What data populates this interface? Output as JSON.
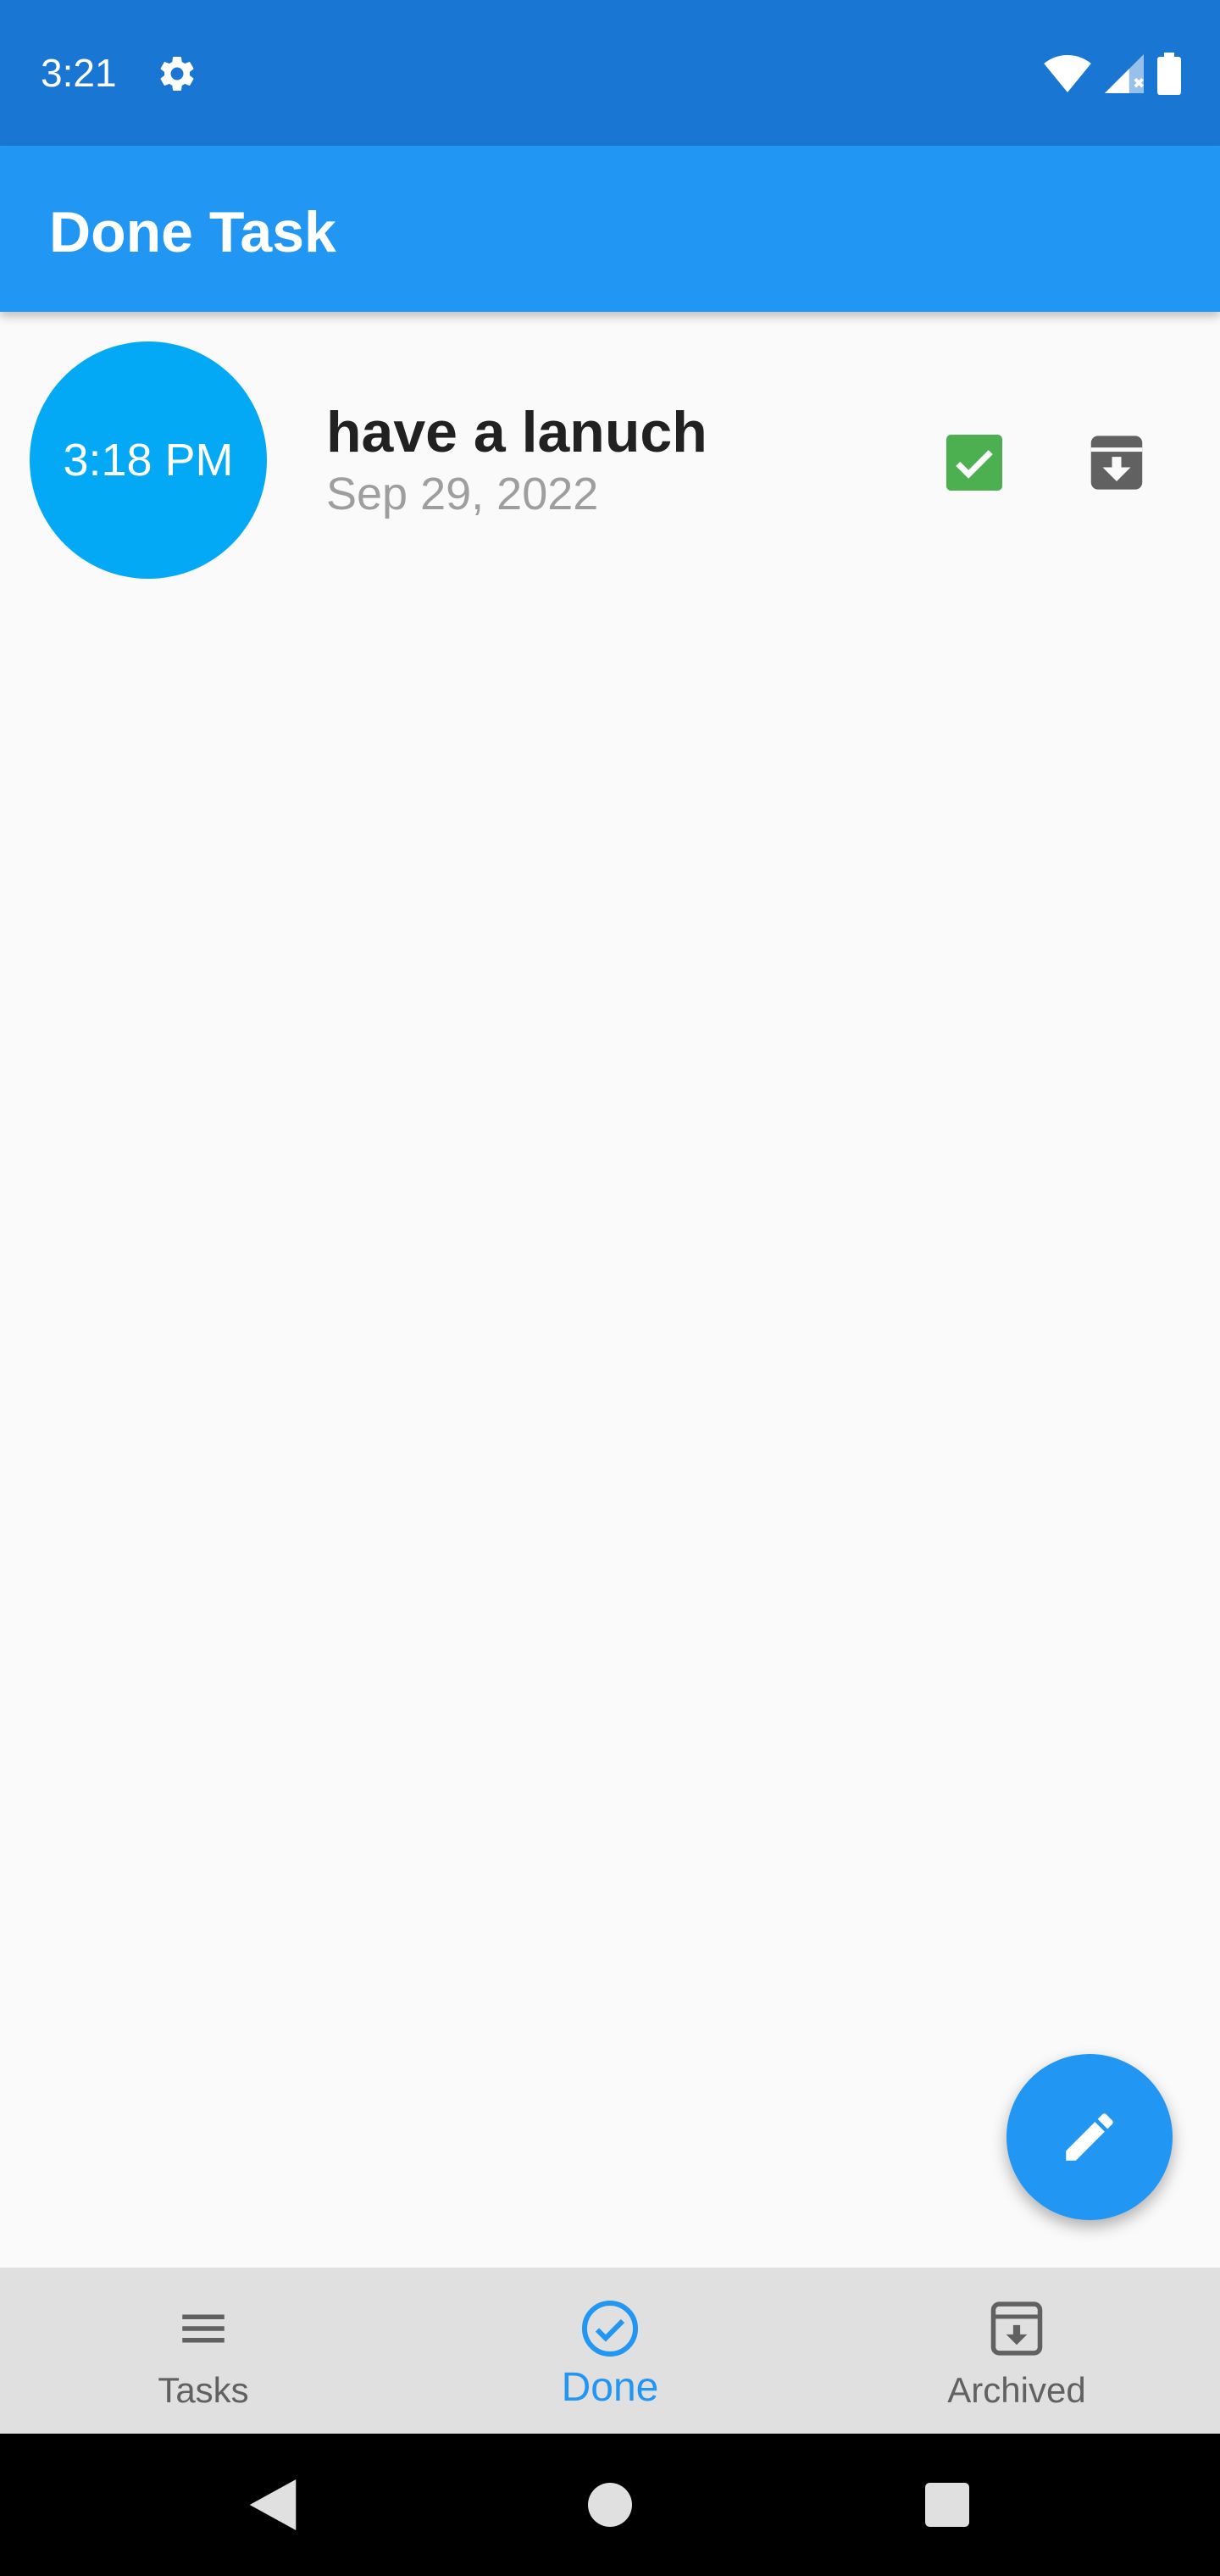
{
  "status_bar": {
    "time": "3:21"
  },
  "app_bar": {
    "title": "Done Task"
  },
  "tasks": [
    {
      "time": "3:18 PM",
      "title": "have a lanuch",
      "date": "Sep 29, 2022"
    }
  ],
  "bottom_nav": {
    "items": [
      {
        "label": "Tasks",
        "icon": "menu-icon",
        "active": false
      },
      {
        "label": "Done",
        "icon": "check-circle-icon",
        "active": true
      },
      {
        "label": "Archived",
        "icon": "archive-icon",
        "active": false
      }
    ]
  },
  "colors": {
    "status_bar": "#1976d2",
    "app_bar": "#2196f3",
    "time_circle": "#03a9f4",
    "check": "#4caf50",
    "nav_active": "#2196f3",
    "nav_inactive": "#616161"
  }
}
